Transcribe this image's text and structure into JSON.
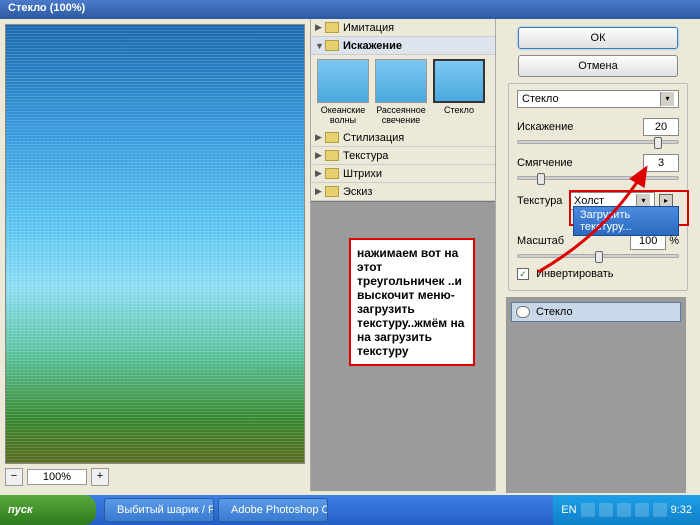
{
  "window": {
    "title": "Стекло (100%)"
  },
  "zoom": {
    "value": "100%",
    "minus": "−",
    "plus": "+"
  },
  "folders": {
    "imitation": "Имитация",
    "distortion": "Искажение",
    "stylization": "Стилизация",
    "texture": "Текстура",
    "strokes": "Штрихи",
    "sketch": "Эскиз"
  },
  "thumbs": {
    "ocean": "Океанские волны",
    "diffuse": "Рассеянное свечение",
    "glass": "Стекло"
  },
  "annotation": "нажимаем вот на этот треугольничек ..и выскочит меню-загрузить текстуру..жмём на на загрузить текстуру",
  "buttons": {
    "ok": "ОК",
    "cancel": "Отмена"
  },
  "filter": {
    "name": "Стекло",
    "distortion_label": "Искажение",
    "distortion_value": "20",
    "smoothness_label": "Смягчение",
    "smoothness_value": "3",
    "texture_label": "Текстура",
    "texture_value": "Холст",
    "load_texture": "Загрузить текстуру...",
    "scale_label": "Масштаб",
    "scale_value": "100",
    "scale_suffix": "%",
    "invert_label": "Инвертировать"
  },
  "layer": {
    "name": "Стекло"
  },
  "taskbar": {
    "start": "пуск",
    "item1": "Выбитый шарик / Ph...",
    "item2": "Adobe Photoshop CS...",
    "lang": "EN",
    "time": "9:32"
  }
}
